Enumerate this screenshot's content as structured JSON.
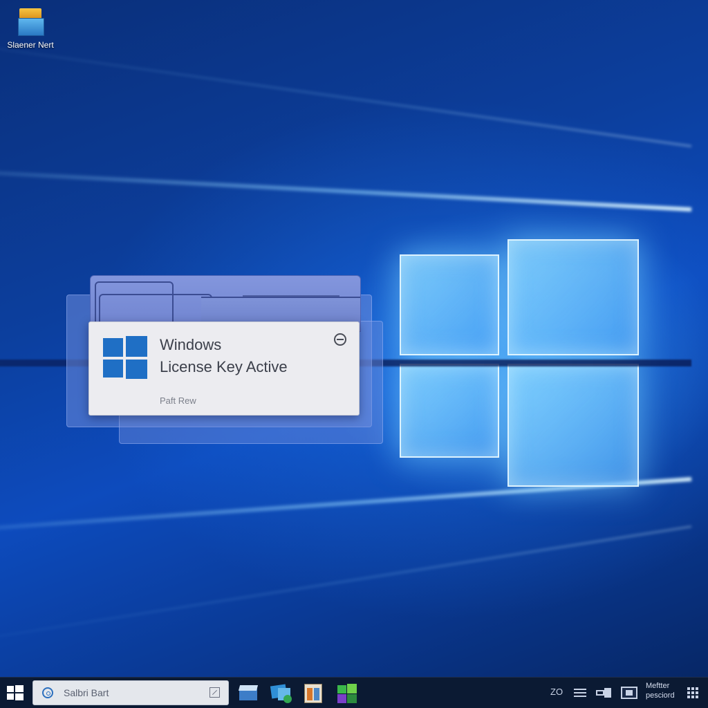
{
  "desktop": {
    "icons": [
      {
        "label": "Slaener Nert",
        "icon": "folder-window-icon"
      }
    ]
  },
  "notification": {
    "title": "Windows",
    "message": "License Key Active",
    "footer": "Paft Rew",
    "icon": "windows-logo-icon",
    "dismiss_icon": "minus-circle-icon"
  },
  "taskbar": {
    "start_icon": "windows-start-icon",
    "search": {
      "placeholder": "Salbri Bart",
      "icon": "search-icon",
      "right_icon": "edit-icon"
    },
    "pinned_apps": [
      {
        "icon": "mail-icon"
      },
      {
        "icon": "photos-icon"
      },
      {
        "icon": "files-icon"
      },
      {
        "icon": "store-icon"
      }
    ],
    "tray": {
      "items": [
        {
          "icon": "clock-status-icon",
          "text": "ZO"
        },
        {
          "icon": "network-icon"
        },
        {
          "icon": "battery-icon"
        },
        {
          "icon": "display-icon"
        }
      ],
      "clock_line1": "Meftter",
      "clock_line2": "pesciord",
      "notification_icon": "action-center-icon"
    }
  },
  "colors": {
    "accent": "#1f6fc5",
    "taskbar": "#0b1a33",
    "card": "#ececf0"
  }
}
